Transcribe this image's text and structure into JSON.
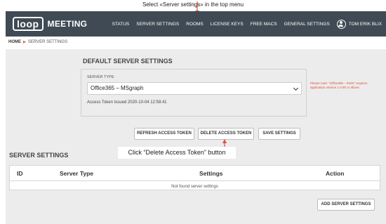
{
  "annotations": {
    "top_caption": "Select «Server settings» in the top menu",
    "callout": "Click “Delete Access Token” button"
  },
  "header": {
    "logo_box": "loop",
    "logo_text": "MEETING",
    "nav": [
      "STATUS",
      "SERVER SETTINGS",
      "ROOMS",
      "LICENSE KEYS",
      "FREE MACS",
      "GENERAL SETTINGS"
    ],
    "user": "TOM ERIK BLIX"
  },
  "breadcrumb": {
    "home": "HOME",
    "current": "SERVER SETTINGS"
  },
  "default_settings": {
    "title": "DEFAULT SERVER SETTINGS",
    "server_type_label": "SERVER TYPE:",
    "server_type_value": "Office365 – MSgraph",
    "token_text": "Access Token Issued 2020-10-04 12:58:41",
    "note": "Please note: \"Office365 – EWS\" requires application version 1.0.90 or above."
  },
  "buttons": {
    "refresh": "REFRESH ACCESS TOKEN",
    "delete": "DELETE ACCESS TOKEN",
    "save": "SAVE SETTINGS",
    "add": "ADD SERVER SETTINGS"
  },
  "server_settings": {
    "title": "SERVER SETTINGS",
    "columns": [
      "ID",
      "Server Type",
      "Settings",
      "Action"
    ],
    "empty_message": "Not found server settings"
  },
  "colors": {
    "navbar": "#3f4a54",
    "accent": "#e0513b",
    "panel": "#ececec"
  }
}
